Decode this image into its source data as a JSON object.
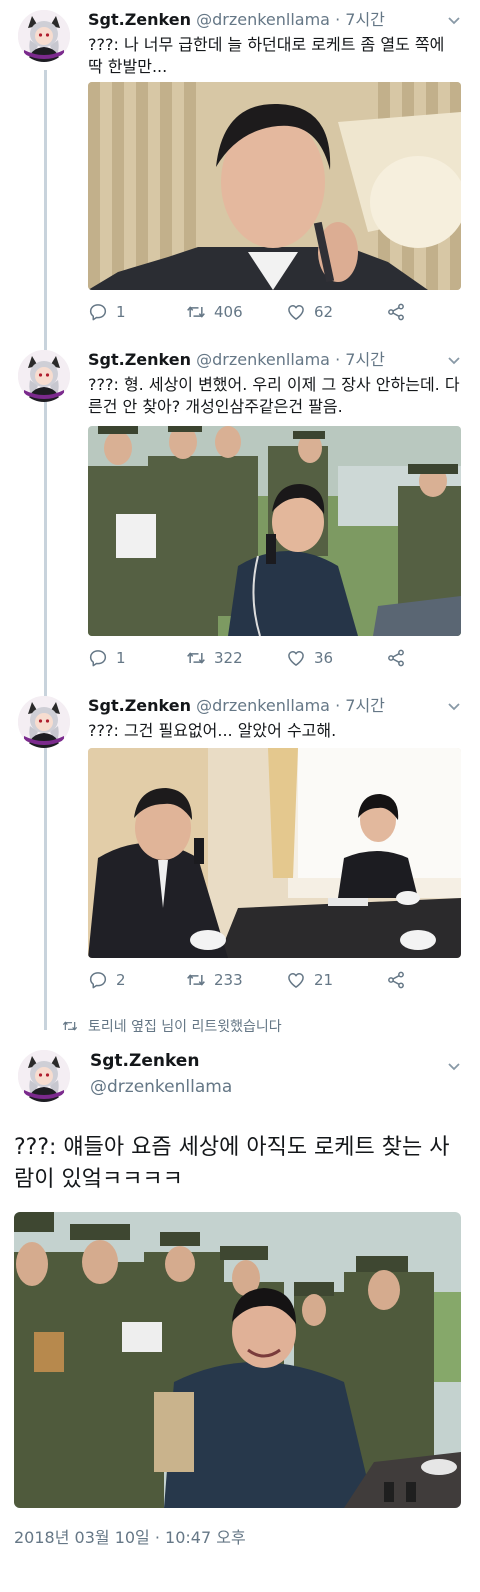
{
  "tweets": [
    {
      "name": "Sgt.Zenken",
      "handle": "@drzenkenllama",
      "separator": "·",
      "time": "7시간",
      "text": "???: 나 너무 급한데 늘 하던대로 로케트 좀 열도 쪽에 딱 한발만...",
      "replies": "1",
      "retweets": "406",
      "likes": "62"
    },
    {
      "name": "Sgt.Zenken",
      "handle": "@drzenkenllama",
      "separator": "·",
      "time": "7시간",
      "text": "???: 형. 세상이 변했어. 우리 이제 그 장사 안하는데. 다른건 안 찾아? 개성인삼주같은건 팔음.",
      "replies": "1",
      "retweets": "322",
      "likes": "36"
    },
    {
      "name": "Sgt.Zenken",
      "handle": "@drzenkenllama",
      "separator": "·",
      "time": "7시간",
      "text": "???: 그건 필요없어... 알았어 수고해.",
      "replies": "2",
      "retweets": "233",
      "likes": "21"
    }
  ],
  "retweet_note": "토리네 옆집 님이 리트윗했습니다",
  "main_tweet": {
    "name": "Sgt.Zenken",
    "handle": "@drzenkenllama",
    "text": "???: 얘들아 요즘 세상에 아직도 로케트 찾는 사람이 있엌ㅋㅋㅋㅋ",
    "timestamp": "2018년 03월 10일 · 10:47 오후"
  },
  "icons": {
    "reply": "reply-icon",
    "retweet": "retweet-icon",
    "like": "heart-icon",
    "share": "share-icon",
    "caret": "chevron-down-icon"
  },
  "colors": {
    "text": "#14171a",
    "muted": "#657786",
    "thread_line": "#c8d3dc"
  }
}
